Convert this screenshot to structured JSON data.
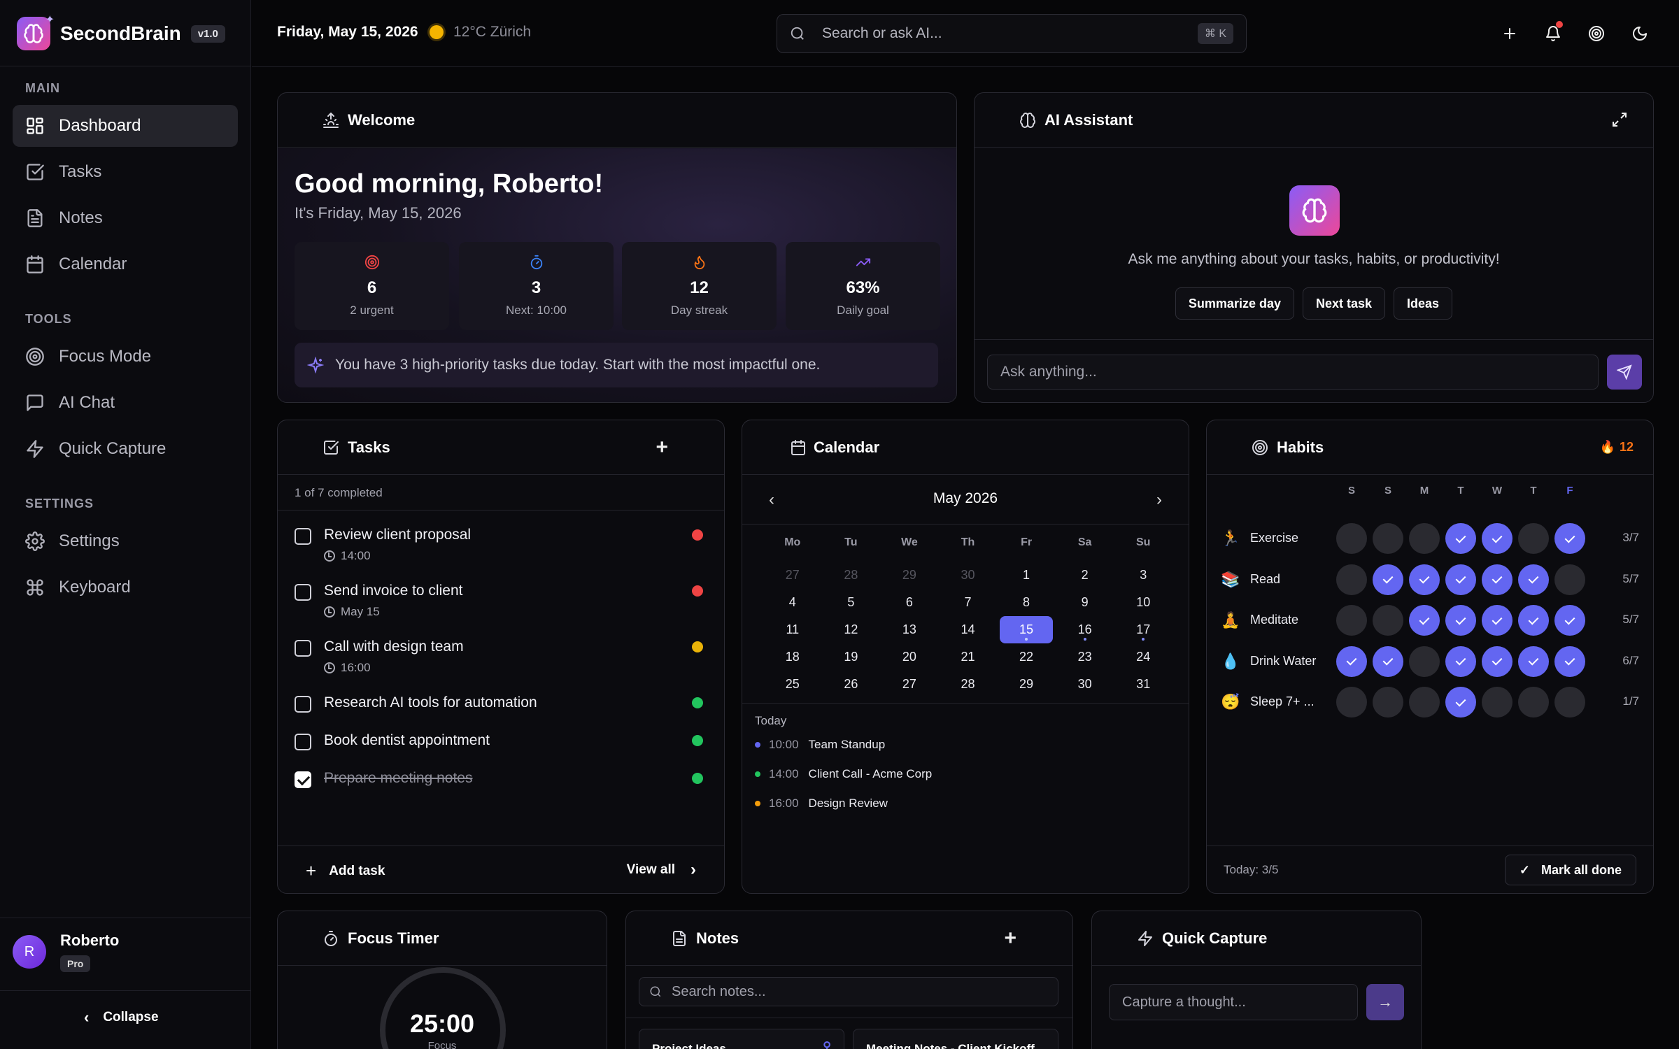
{
  "brand": {
    "name": "SecondBrain",
    "version": "v1.0"
  },
  "sidebar": {
    "sections": [
      {
        "title": "MAIN",
        "items": [
          "Dashboard",
          "Tasks",
          "Notes",
          "Calendar"
        ]
      },
      {
        "title": "TOOLS",
        "items": [
          "Focus Mode",
          "AI Chat",
          "Quick Capture"
        ]
      },
      {
        "title": "SETTINGS",
        "items": [
          "Settings",
          "Keyboard"
        ]
      }
    ],
    "active": "Dashboard",
    "user": {
      "initial": "R",
      "name": "Roberto",
      "plan": "Pro"
    },
    "collapse_label": "Collapse"
  },
  "topbar": {
    "date": "Friday, May 15, 2026",
    "weather": "12°C Zürich",
    "search_placeholder": "Search or ask AI...",
    "shortcut": "⌘ K"
  },
  "welcome": {
    "title": "Welcome",
    "greeting": "Good morning, Roberto!",
    "subtitle": "It's Friday, May 15, 2026",
    "stats": [
      {
        "icon": "target-icon",
        "value": "6",
        "label": "2 urgent",
        "color": "#ef4444"
      },
      {
        "icon": "timer-icon",
        "value": "3",
        "label": "Next: 10:00",
        "color": "#3b82f6"
      },
      {
        "icon": "flame-icon",
        "value": "12",
        "label": "Day streak",
        "color": "#f97316"
      },
      {
        "icon": "trending-up-icon",
        "value": "63%",
        "label": "Daily goal",
        "color": "#8b5cf6"
      }
    ],
    "tip": "You have 3 high-priority tasks due today. Start with the most impactful one."
  },
  "ai": {
    "title": "AI Assistant",
    "prompt": "Ask me anything about your tasks, habits, or productivity!",
    "chips": [
      "Summarize day",
      "Next task",
      "Ideas"
    ],
    "input_placeholder": "Ask anything..."
  },
  "tasks": {
    "title": "Tasks",
    "summary": "1 of 7 completed",
    "items": [
      {
        "title": "Review client proposal",
        "meta": "14:00",
        "priority": "#ef4444",
        "done": false
      },
      {
        "title": "Send invoice to client",
        "meta": "May 15",
        "priority": "#ef4444",
        "done": false
      },
      {
        "title": "Call with design team",
        "meta": "16:00",
        "priority": "#eab308",
        "done": false
      },
      {
        "title": "Research AI tools for automation",
        "meta": "",
        "priority": "#22c55e",
        "done": false
      },
      {
        "title": "Book dentist appointment",
        "meta": "",
        "priority": "#22c55e",
        "done": false
      },
      {
        "title": "Prepare meeting notes",
        "meta": "",
        "priority": "#22c55e",
        "done": true
      }
    ],
    "add_label": "Add task",
    "view_all": "View all"
  },
  "calendar": {
    "title": "Calendar",
    "month": "May 2026",
    "dow": [
      "Mo",
      "Tu",
      "We",
      "Th",
      "Fr",
      "Sa",
      "Su"
    ],
    "days": [
      "27",
      "28",
      "29",
      "30",
      "1",
      "2",
      "3",
      "4",
      "5",
      "6",
      "7",
      "8",
      "9",
      "10",
      "11",
      "12",
      "13",
      "14",
      "15",
      "16",
      "17",
      "18",
      "19",
      "20",
      "21",
      "22",
      "23",
      "24",
      "25",
      "26",
      "27",
      "28",
      "29",
      "30",
      "31"
    ],
    "muted_count": 4,
    "selected": "15",
    "event_days": [
      "15",
      "16",
      "17"
    ],
    "today_label": "Today",
    "events": [
      {
        "time": "10:00",
        "name": "Team Standup",
        "color": "#6366f1"
      },
      {
        "time": "14:00",
        "name": "Client Call - Acme Corp",
        "color": "#22c55e"
      },
      {
        "time": "16:00",
        "name": "Design Review",
        "color": "#f59e0b"
      }
    ]
  },
  "habits": {
    "title": "Habits",
    "streak": "12",
    "days": [
      "S",
      "S",
      "M",
      "T",
      "W",
      "T",
      "F"
    ],
    "today_index": 6,
    "rows": [
      {
        "emoji": "🏃",
        "name": "Exercise",
        "done": [
          0,
          0,
          0,
          1,
          1,
          0,
          1
        ],
        "count": "3/7"
      },
      {
        "emoji": "📚",
        "name": "Read",
        "done": [
          0,
          1,
          1,
          1,
          1,
          1,
          0
        ],
        "count": "5/7"
      },
      {
        "emoji": "🧘",
        "name": "Meditate",
        "done": [
          0,
          0,
          1,
          1,
          1,
          1,
          1
        ],
        "count": "5/7"
      },
      {
        "emoji": "💧",
        "name": "Drink Water",
        "done": [
          1,
          1,
          0,
          1,
          1,
          1,
          1
        ],
        "count": "6/7"
      },
      {
        "emoji": "😴",
        "name": "Sleep 7+ ...",
        "done": [
          0,
          0,
          0,
          1,
          0,
          0,
          0
        ],
        "count": "1/7"
      }
    ],
    "today_summary": "Today: 3/5",
    "mark_all": "Mark all done"
  },
  "focus": {
    "title": "Focus Timer",
    "time": "25:00",
    "label": "Focus"
  },
  "notes": {
    "title": "Notes",
    "search_placeholder": "Search notes...",
    "cards": [
      "Project Ideas",
      "Meeting Notes - Client Kickoff"
    ]
  },
  "capture": {
    "title": "Quick Capture",
    "placeholder": "Capture a thought..."
  }
}
